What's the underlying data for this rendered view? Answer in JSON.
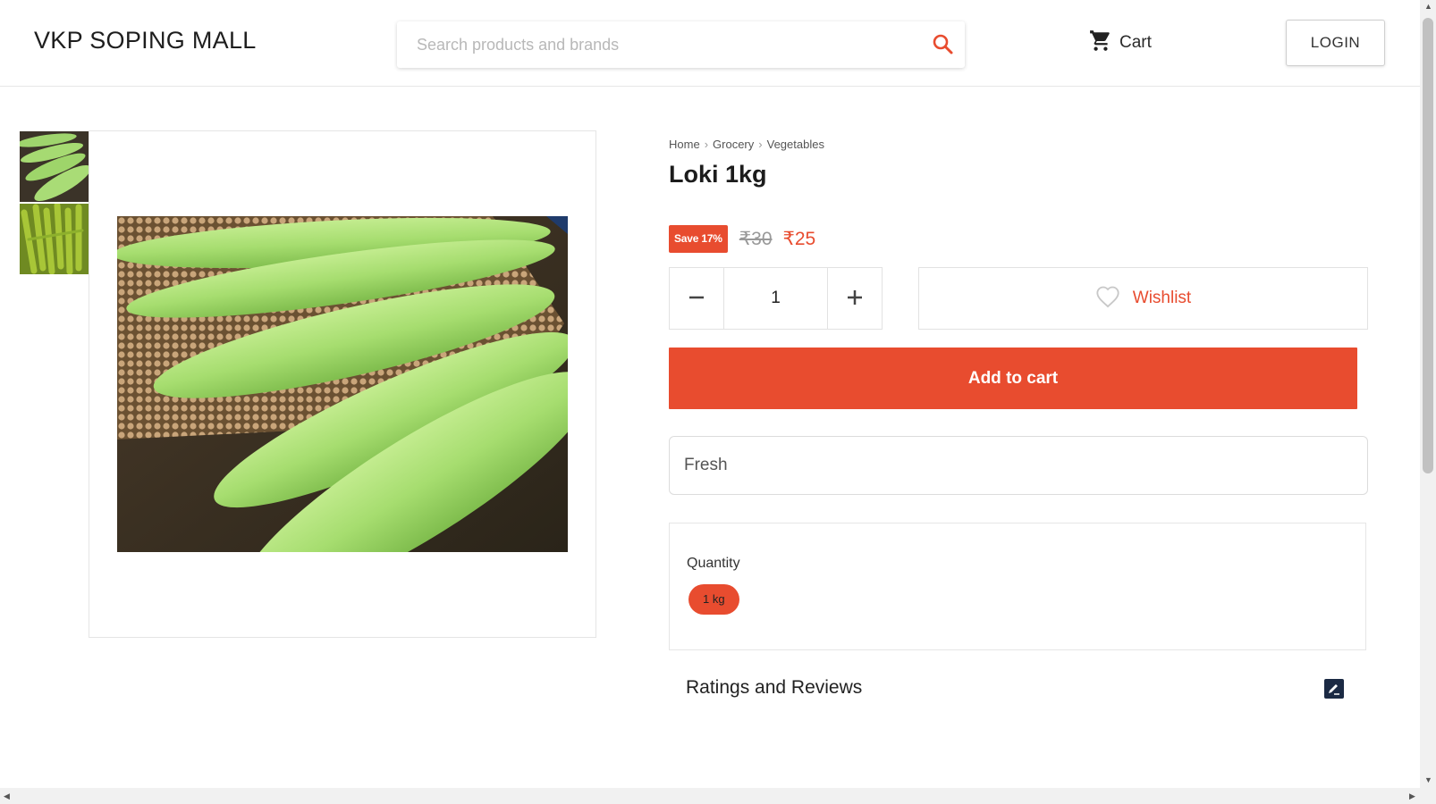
{
  "header": {
    "brand": "VKP SOPING MALL",
    "search_placeholder": "Search products and brands",
    "cart_label": "Cart",
    "login_label": "LOGIN"
  },
  "breadcrumb": [
    "Home",
    "Grocery",
    "Vegetables"
  ],
  "product": {
    "title": "Loki 1kg",
    "save_badge": "Save 17%",
    "mrp": "₹30",
    "price": "₹25",
    "quantity": "1",
    "wishlist_label": "Wishlist",
    "add_to_cart_label": "Add to cart",
    "note_value": "Fresh",
    "variant_label": "Quantity",
    "variant_selected": "1 kg",
    "reviews_title": "Ratings and Reviews"
  },
  "colors": {
    "accent": "#e84c2f",
    "text": "#222222",
    "border": "#e2e2e2"
  },
  "icons": {
    "search": "search-icon",
    "cart": "cart-icon",
    "minus": "minus-icon",
    "plus": "plus-icon",
    "wishlist": "heart-icon",
    "review": "edit-review-icon"
  }
}
